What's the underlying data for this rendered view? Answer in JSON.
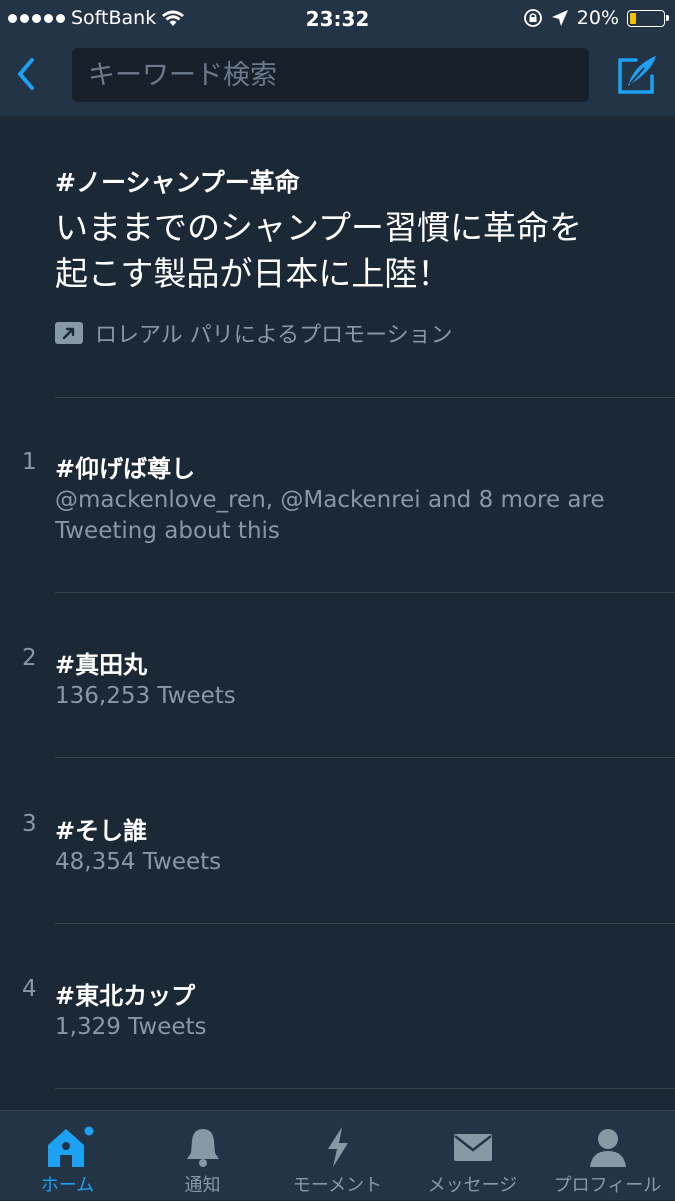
{
  "status_bar": {
    "carrier": "SoftBank",
    "time": "23:32",
    "battery": "20%",
    "battery_level": 0.2,
    "icons": [
      "signal-dots-icon",
      "wifi-icon",
      "rotation-lock-icon",
      "location-arrow-icon",
      "battery-icon"
    ]
  },
  "header": {
    "search_placeholder": "キーワード検索",
    "back_icon": "chevron-left-icon",
    "compose_icon": "compose-icon"
  },
  "promoted_trend": {
    "hashtag": "#ノーシャンプー革命",
    "headline_line1": "いままでのシャンプー習慣に革命を",
    "headline_line2": "起こす製品が日本に上陸！",
    "promoted_by": "ロレアル パリによるプロモーション",
    "icon": "promoted-arrow-icon"
  },
  "trends": [
    {
      "rank": "1",
      "hashtag": "#仰げば尊し",
      "meta_line1": "@mackenlove_ren, @Mackenrei and 8 more are",
      "meta_line2": "Tweeting about this"
    },
    {
      "rank": "2",
      "hashtag": "#真田丸",
      "meta_line1": "136,253 Tweets"
    },
    {
      "rank": "3",
      "hashtag": "#そし誰",
      "meta_line1": "48,354 Tweets"
    },
    {
      "rank": "4",
      "hashtag": "#東北カップ",
      "meta_line1": "1,329 Tweets"
    }
  ],
  "tab_bar": {
    "tabs": [
      {
        "label": "ホーム",
        "icon": "home-icon",
        "active": true
      },
      {
        "label": "通知",
        "icon": "bell-icon",
        "active": false
      },
      {
        "label": "モーメント",
        "icon": "lightning-icon",
        "active": false
      },
      {
        "label": "メッセージ",
        "icon": "envelope-icon",
        "active": false
      },
      {
        "label": "プロフィール",
        "icon": "person-icon",
        "active": false
      }
    ]
  },
  "colors": {
    "background": "#1b2836",
    "bar": "#243447",
    "accent": "#1da1f2",
    "secondary_text": "#8899a6",
    "battery_fill": "#f2c200"
  }
}
